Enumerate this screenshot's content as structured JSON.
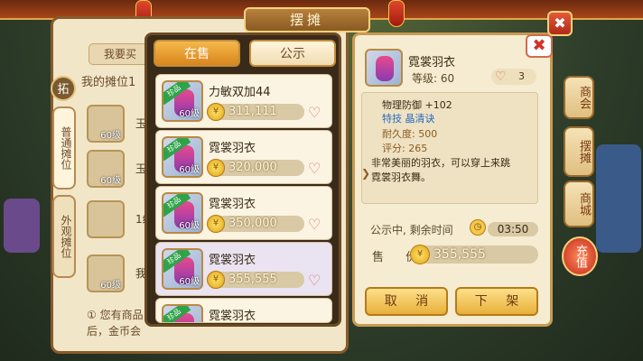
{
  "title": "摆摊",
  "back": {
    "tab_buy": "我要买",
    "my_stall": "我的摊位1",
    "side_tabs": [
      "普通摊位",
      "外观摊位"
    ],
    "pin": "拓",
    "slots": [
      {
        "level": "60级",
        "text": "玉"
      },
      {
        "level": "60级",
        "text": "玉"
      },
      {
        "level": "",
        "text": "1级"
      },
      {
        "level": "60级",
        "text": "我"
      }
    ],
    "notice_lines": [
      "① 您有商品",
      "后，金币会"
    ]
  },
  "tabs": {
    "on_sale": "在售",
    "public": "公示"
  },
  "items": [
    {
      "name": "力敏双加44",
      "price": "311,111",
      "level": "60级",
      "badge": "珍品",
      "selected": false
    },
    {
      "name": "霓裳羽衣",
      "price": "320,000",
      "level": "60级",
      "badge": "珍品",
      "selected": false
    },
    {
      "name": "霓裳羽衣",
      "price": "350,000",
      "level": "60级",
      "badge": "珍品",
      "selected": false
    },
    {
      "name": "霓裳羽衣",
      "price": "355,555",
      "level": "60级",
      "badge": "珍品",
      "selected": true
    },
    {
      "name": "霓裳羽衣",
      "price": "",
      "level": "60级",
      "badge": "珍品",
      "selected": false
    }
  ],
  "detail": {
    "name": "霓裳羽衣",
    "level": "等级: 60",
    "likes": "3",
    "stats": [
      {
        "text": "物理防御 +102",
        "color": "#3a2a14"
      },
      {
        "text": "特技 晶清诀",
        "color": "#2a6ac0"
      },
      {
        "text": "耐久度: 500",
        "color": "#8a5a22"
      },
      {
        "text": "评分: 265",
        "color": "#8a5a22"
      },
      {
        "text": "非常美丽的羽衣，可以穿上来跳",
        "color": "#3a2a14"
      },
      {
        "text": "霓裳羽衣舞。",
        "color": "#3a2a14"
      }
    ],
    "timer_label": "公示中, 剩余时间",
    "timer_value": "03:50",
    "sell_label": "售 价",
    "sell_price": "355,555",
    "cancel_label": "取 消",
    "unlist_label": "下 架"
  },
  "right_menu": [
    "商会",
    "摆摊",
    "商城"
  ],
  "recharge": "充值",
  "coin_glyph": "¥",
  "heart_glyph": "♡",
  "close_glyph": "✖"
}
